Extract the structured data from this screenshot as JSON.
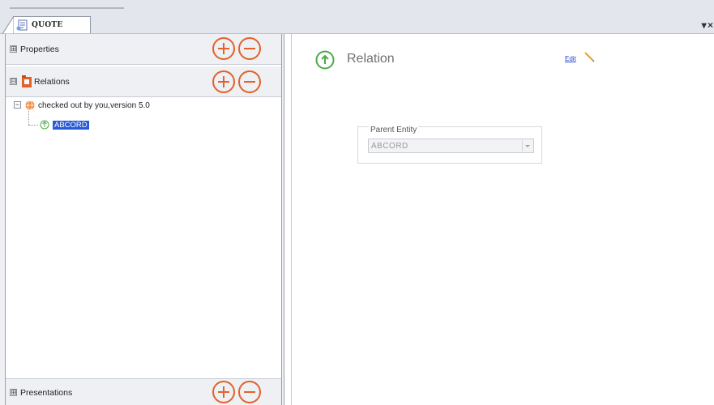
{
  "window": {
    "tab_label": "QUOTE",
    "pin_close_glyph": "▾ ×"
  },
  "left_panel": {
    "sections": {
      "properties": {
        "label": "Properties",
        "expander": "⊞"
      },
      "relations": {
        "label": "Relations",
        "expander": "⊟"
      },
      "presentations": {
        "label": "Presentations",
        "expander": "⊞"
      }
    },
    "tree": {
      "root_label": "checked out by you,version 5.0",
      "child_label": "ABCORD"
    }
  },
  "detail": {
    "title": "Relation",
    "edit_label": "Edit",
    "parent_entity_label": "Parent Entity",
    "parent_entity_value": "ABCORD"
  },
  "colors": {
    "accent_orange": "#e2622a",
    "relation_green": "#4caa47",
    "selection_blue": "#2a5bd7"
  },
  "icons": [
    "tab-document-icon",
    "relations-folder-icon",
    "globe-version-icon",
    "relation-arrow-icon",
    "pencil-edit-icon",
    "plus-circle-icon",
    "minus-circle-icon",
    "dropdown-arrow-icon"
  ]
}
